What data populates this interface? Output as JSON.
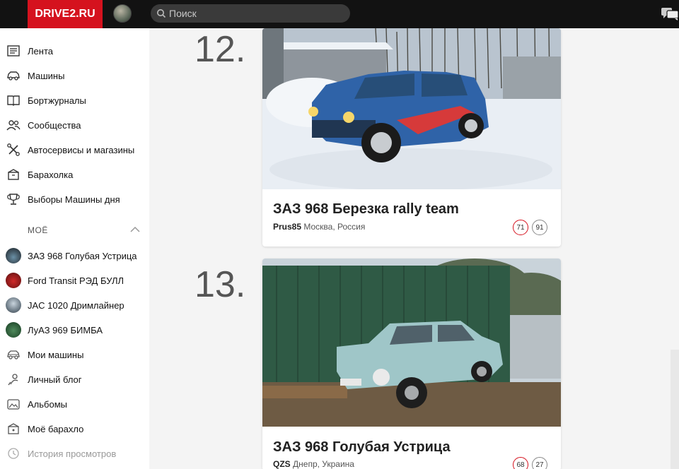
{
  "header": {
    "logo": "DRIVE2.RU",
    "search_placeholder": "Поиск",
    "colors": {
      "bar": "#121212",
      "logo_bg": "#d5121e"
    }
  },
  "sidebar": {
    "main_items": [
      {
        "label": "Лента",
        "icon": "feed-icon"
      },
      {
        "label": "Машины",
        "icon": "car-icon"
      },
      {
        "label": "Бортжурналы",
        "icon": "logbook-icon"
      },
      {
        "label": "Сообщества",
        "icon": "communities-icon"
      },
      {
        "label": "Автосервисы и магазины",
        "icon": "tools-icon"
      },
      {
        "label": "Барахолка",
        "icon": "market-icon"
      },
      {
        "label": "Выборы Машины дня",
        "icon": "trophy-icon"
      }
    ],
    "section_title": "МОЁ",
    "my_cars": [
      {
        "label": "ЗАЗ 968 Голубая Устрица"
      },
      {
        "label": "Ford Transit РЭД БУЛЛ"
      },
      {
        "label": "JAC 1020 Дримлайнер"
      },
      {
        "label": "ЛуАЗ 969 БИМБА"
      }
    ],
    "my_items": [
      {
        "label": "Мои машины",
        "icon": "garage-icon"
      },
      {
        "label": "Личный блог",
        "icon": "blog-icon"
      },
      {
        "label": "Альбомы",
        "icon": "album-icon"
      },
      {
        "label": "Моё барахло",
        "icon": "my-market-icon"
      },
      {
        "label": "История просмотров",
        "icon": "history-icon"
      }
    ]
  },
  "feed": [
    {
      "rank": "12.",
      "title": "ЗАЗ 968 Березка rally team",
      "author": "Prus85",
      "location": "Москва, Россия",
      "likes": "71",
      "comments": "91"
    },
    {
      "rank": "13.",
      "title": "ЗАЗ 968 Голубая Устрица",
      "author": "QZS",
      "location": "Днепр, Украина",
      "likes": "68",
      "comments": "27"
    }
  ]
}
